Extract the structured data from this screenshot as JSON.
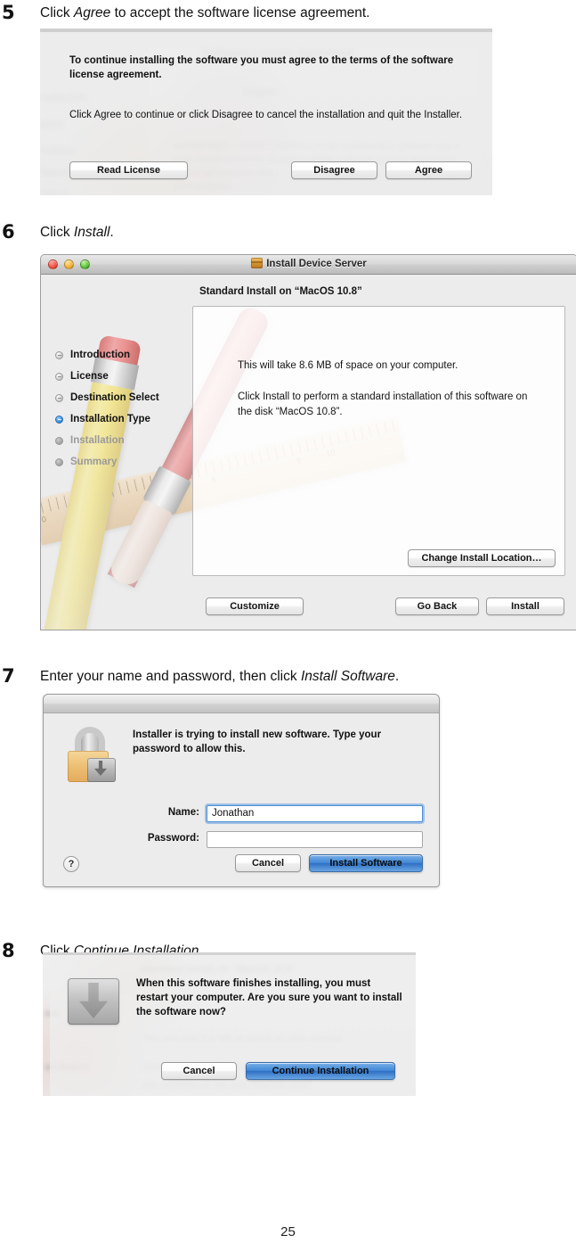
{
  "page": {
    "number": "25"
  },
  "steps": [
    {
      "number": "5",
      "instruction_before": "Click ",
      "instruction_emphasis": "Agree",
      "instruction_after": " to accept the software license agreement."
    },
    {
      "number": "6",
      "instruction_before": "Click ",
      "instruction_emphasis": "Install",
      "instruction_after": "."
    },
    {
      "number": "7",
      "instruction_before": "Enter your name and password, then click ",
      "instruction_emphasis": "Install Software",
      "instruction_after": "."
    },
    {
      "number": "8",
      "instruction_before": "Click ",
      "instruction_emphasis": "Continue Installation",
      "instruction_after": "."
    }
  ],
  "license_sheet": {
    "headline": "To continue installing the software you must agree to the terms of the software license agreement.",
    "body": "Click Agree to continue or click Disagree to cancel the installation and quit the Installer.",
    "read_license_label": "Read License",
    "disagree_label": "Disagree",
    "agree_label": "Agree",
    "background_blurred": {
      "title": "Software License Agreement",
      "language_popup": "English",
      "sidebar": [
        "roduction",
        "ense",
        "ination",
        "llation",
        "lation"
      ],
      "license_text_1": "IMPORTANT— READ CAREFULLY. By installing this software, you a",
      "license_text_2": "to be legally bound by the terms of this Software License Agreement.",
      "license_text_3": "do not agree to the t                          the",
      "license_text_4": "ation program."
    }
  },
  "installer_window": {
    "title": "Install Device Server",
    "icon": "package-icon",
    "traffic_lights": [
      "close",
      "minimize",
      "zoom"
    ],
    "headline": "Standard Install on “MacOS 10.8”",
    "sidebar": [
      {
        "label": "Introduction",
        "state": "done"
      },
      {
        "label": "License",
        "state": "done"
      },
      {
        "label": "Destination Select",
        "state": "done"
      },
      {
        "label": "Installation Type",
        "state": "active"
      },
      {
        "label": "Installation",
        "state": "pending"
      },
      {
        "label": "Summary",
        "state": "pending"
      }
    ],
    "pane_text_1": "This will take 8.6 MB of space on your computer.",
    "pane_text_2": "Click Install to perform a standard installation of this software on the disk “MacOS 10.8”.",
    "change_location_label": "Change Install Location…",
    "customize_label": "Customize",
    "go_back_label": "Go Back",
    "install_label": "Install",
    "wallpaper_ruler_numbers": [
      "0",
      "1",
      "4",
      "5",
      "6",
      "9",
      "10"
    ]
  },
  "auth_dialog": {
    "icon": "lock-icon",
    "message": "Installer is trying to install new software. Type your password to allow this.",
    "name_label": "Name:",
    "name_value": "Jonathan",
    "password_label": "Password:",
    "password_value": "",
    "help_label": "?",
    "cancel_label": "Cancel",
    "install_software_label": "Install Software"
  },
  "restart_sheet": {
    "icon": "hard-drive-download-icon",
    "message": "When this software finishes installing, you must restart your computer. Are you sure you want to install the software now?",
    "cancel_label": "Cancel",
    "continue_label": "Continue Installation",
    "background_blurred": {
      "headline": "Standard Install on “MacOS 10.8”",
      "sidebar": [
        "ion",
        "on Select"
      ],
      "text_1": "This will take 8.6 MB of space on your comput",
      "text_2": "Click Install to perform a standard installation",
      "text_3": "this software on the disk “MacOS 10.8”."
    }
  },
  "colors": {
    "accent_blue": "#3f86d6",
    "window_gray": "#ececec",
    "active_step_dot": "#3f97e0"
  }
}
